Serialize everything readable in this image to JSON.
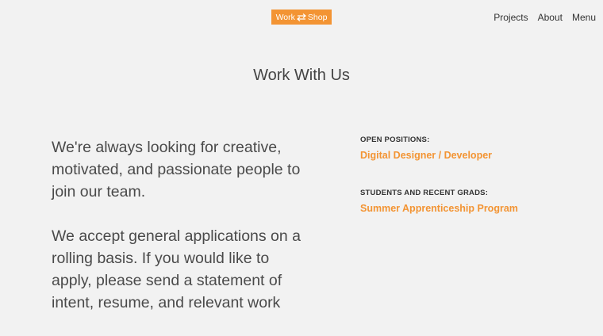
{
  "header": {
    "logo": {
      "left_text": "Work",
      "right_text": "Shop",
      "icon": "double-arrow-icon",
      "bg_color": "#f39433"
    },
    "nav": [
      "Projects",
      "About",
      "Menu"
    ]
  },
  "main": {
    "title": "Work With Us",
    "intro": [
      "We're always looking for creative, motivated, and passionate people to join our team.",
      "We accept general applications on a rolling basis. If you would like to apply, please send a statement of intent, resume, and relevant work"
    ]
  },
  "sidebar": {
    "open_positions_heading": "OPEN POSITIONS:",
    "open_positions_link": "Digital Designer / Developer",
    "students_heading": "STUDENTS AND RECENT GRADS:",
    "students_link": "Summer Apprenticeship Program",
    "accent_color": "#f39433"
  }
}
